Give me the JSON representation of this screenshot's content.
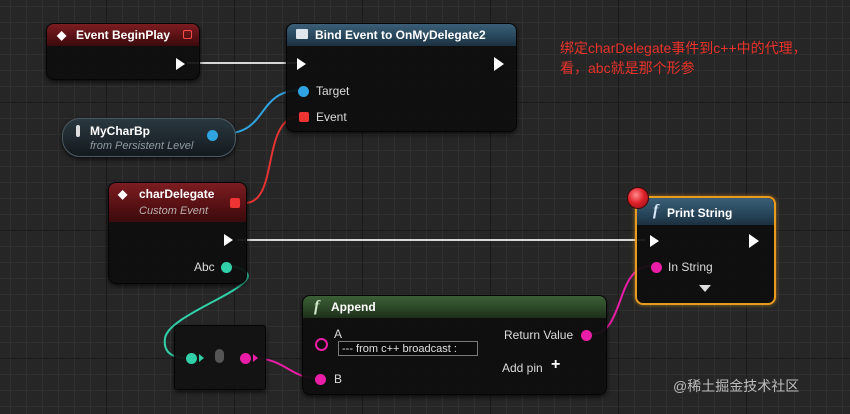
{
  "nodes": {
    "begin_play": {
      "title": "Event BeginPlay"
    },
    "bind_event": {
      "title": "Bind Event to OnMyDelegate2",
      "pins": {
        "target": "Target",
        "event": "Event"
      }
    },
    "my_char_bp": {
      "title": "MyCharBp",
      "subtitle": "from Persistent Level"
    },
    "char_delegate": {
      "title": "charDelegate",
      "subtitle": "Custom Event",
      "pins": {
        "abc": "Abc"
      }
    },
    "print_string": {
      "title": "Print String",
      "pins": {
        "in_string": "In String"
      }
    },
    "append": {
      "title": "Append",
      "pins": {
        "a": "A",
        "a_default": "--- from c++ broadcast :",
        "b": "B",
        "return_value": "Return Value",
        "add_pin": "Add pin"
      }
    }
  },
  "annotation": {
    "line1": "绑定charDelegate事件到c++中的代理，",
    "line2": "看，abc就是那个形参"
  },
  "watermark": "@稀土掘金技术社区",
  "colors": {
    "exec": "#ffffff",
    "object_pin": "#2fa4e0",
    "delegate_pin": "#e33333",
    "struct_pin": "#31d0a8",
    "string_pin": "#ea1ea6",
    "annotation": "#e8322a"
  }
}
